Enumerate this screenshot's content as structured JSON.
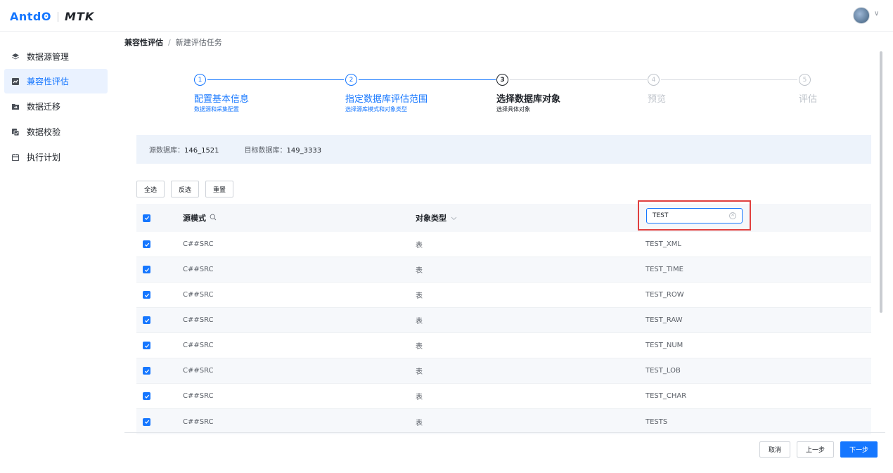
{
  "header": {
    "logo_antd": "Antdʘ",
    "logo_mtk": "MTK",
    "avatar_caret": "∨"
  },
  "sidebar": {
    "items": [
      {
        "label": "数据源管理",
        "icon": "layers-icon",
        "active": false
      },
      {
        "label": "兼容性评估",
        "icon": "assessment-icon",
        "active": true
      },
      {
        "label": "数据迁移",
        "icon": "migrate-icon",
        "active": false
      },
      {
        "label": "数据校验",
        "icon": "verify-icon",
        "active": false
      },
      {
        "label": "执行计划",
        "icon": "calendar-icon",
        "active": false
      }
    ]
  },
  "breadcrumb": {
    "parent": "兼容性评估",
    "separator": "/",
    "current": "新建评估任务"
  },
  "steps": [
    {
      "num": "1",
      "title": "配置基本信息",
      "subtitle": "数据源和采集配置",
      "status": "done"
    },
    {
      "num": "2",
      "title": "指定数据库评估范围",
      "subtitle": "选择源库模式和对象类型",
      "status": "done"
    },
    {
      "num": "3",
      "title": "选择数据库对象",
      "subtitle": "选择具体对象",
      "status": "current"
    },
    {
      "num": "4",
      "title": "预览",
      "subtitle": "",
      "status": "pending"
    },
    {
      "num": "5",
      "title": "评估",
      "subtitle": "",
      "status": "pending"
    }
  ],
  "info": {
    "source_label": "源数据库：",
    "source_value": "146_1521",
    "target_label": "目标数据库：",
    "target_value": "149_3333"
  },
  "actions": {
    "select_all": "全选",
    "invert": "反选",
    "reset": "重置"
  },
  "table": {
    "columns": {
      "schema": "源模式",
      "type": "对象类型"
    },
    "filter_value": "TEST",
    "rows": [
      {
        "schema": "C##SRC",
        "type": "表",
        "name": "TEST_XML"
      },
      {
        "schema": "C##SRC",
        "type": "表",
        "name": "TEST_TIME"
      },
      {
        "schema": "C##SRC",
        "type": "表",
        "name": "TEST_ROW"
      },
      {
        "schema": "C##SRC",
        "type": "表",
        "name": "TEST_RAW"
      },
      {
        "schema": "C##SRC",
        "type": "表",
        "name": "TEST_NUM"
      },
      {
        "schema": "C##SRC",
        "type": "表",
        "name": "TEST_LOB"
      },
      {
        "schema": "C##SRC",
        "type": "表",
        "name": "TEST_CHAR"
      },
      {
        "schema": "C##SRC",
        "type": "表",
        "name": "TESTS"
      }
    ]
  },
  "footer": {
    "cancel": "取消",
    "prev": "上一步",
    "next": "下一步"
  },
  "colors": {
    "primary": "#1677ff",
    "highlight_border": "#e0403f",
    "info_bg": "#edf3fb"
  }
}
